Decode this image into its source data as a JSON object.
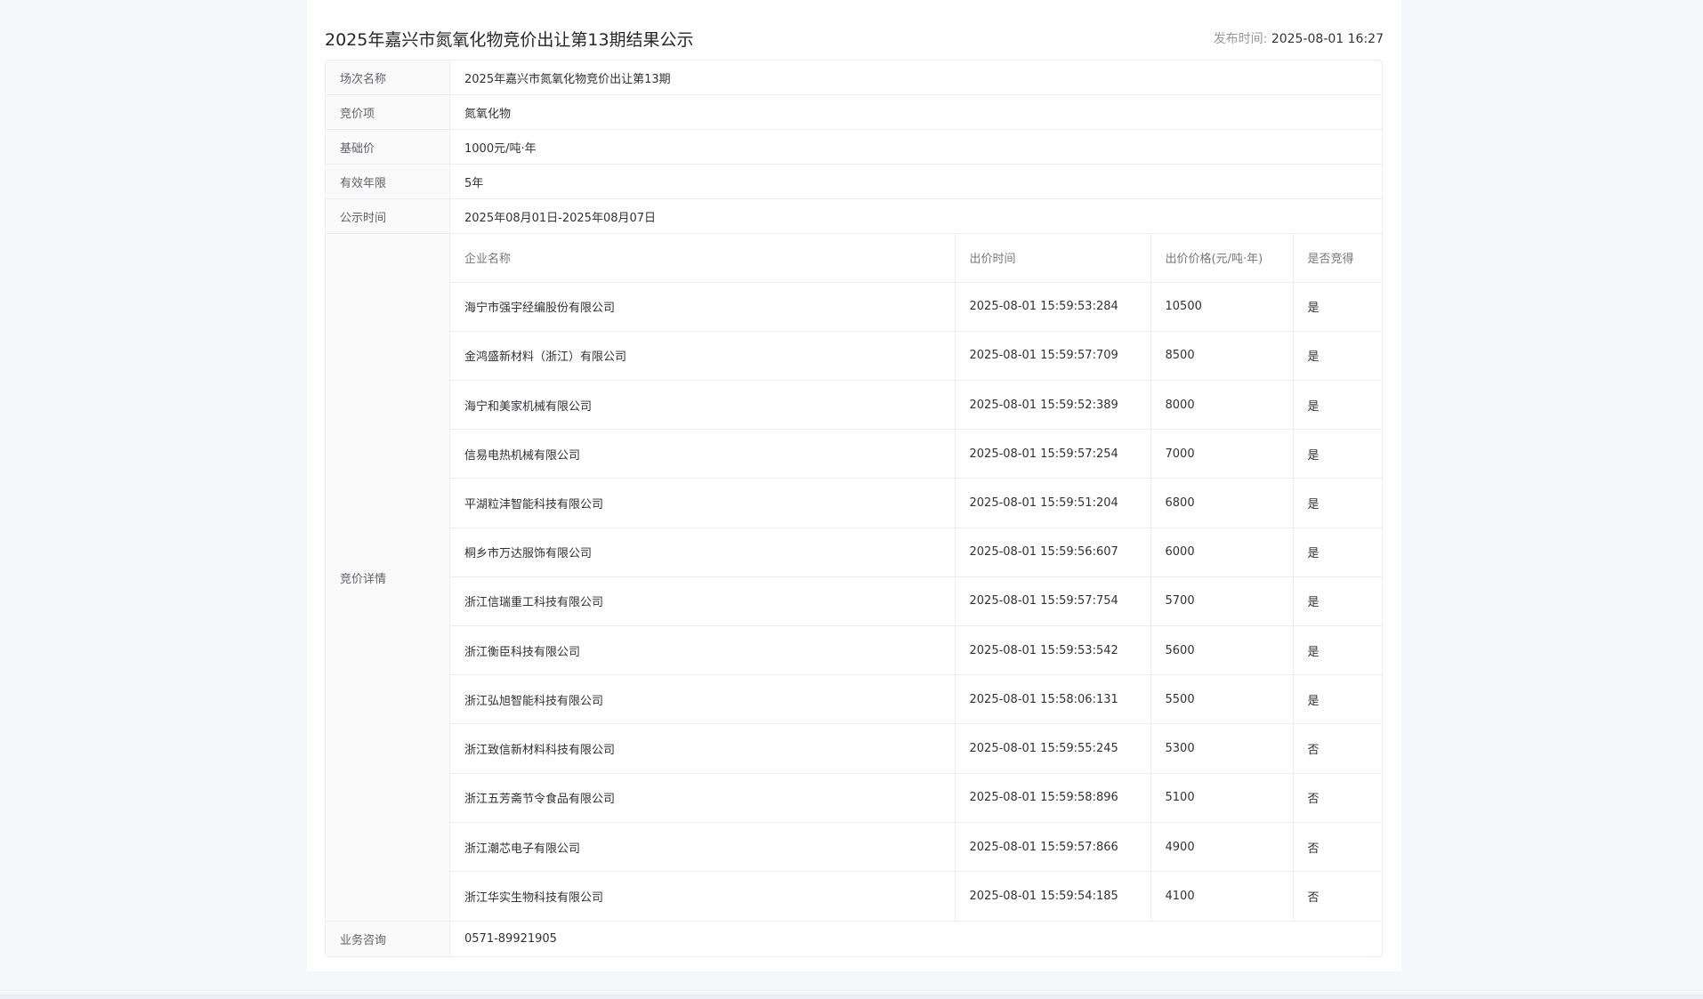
{
  "header": {
    "title": "2025年嘉兴市氮氧化物竞价出让第13期结果公示",
    "publish_label": "发布时间: ",
    "publish_time": "2025-08-01 16:27"
  },
  "info": {
    "session_label": "场次名称",
    "session_value": "2025年嘉兴市氮氧化物竞价出让第13期",
    "item_label": "竞价项",
    "item_value": "氮氧化物",
    "base_price_label": "基础价",
    "base_price_value": "1000元/吨·年",
    "validity_label": "有效年限",
    "validity_value": "5年",
    "period_label": "公示时间",
    "period_value": "2025年08月01日-2025年08月07日",
    "detail_label": "竞价详情",
    "consult_label": "业务咨询",
    "consult_value": "0571-89921905"
  },
  "bids": {
    "columns": [
      "企业名称",
      "出价时间",
      "出价价格(元/吨·年)",
      "是否竞得"
    ],
    "rows": [
      [
        "海宁市强宇经编股份有限公司",
        "2025-08-01 15:59:53:284",
        "10500",
        "是"
      ],
      [
        "金鸿盛新材料（浙江）有限公司",
        "2025-08-01 15:59:57:709",
        "8500",
        "是"
      ],
      [
        "海宁和美家机械有限公司",
        "2025-08-01 15:59:52:389",
        "8000",
        "是"
      ],
      [
        "信易电热机械有限公司",
        "2025-08-01 15:59:57:254",
        "7000",
        "是"
      ],
      [
        "平湖粒沣智能科技有限公司",
        "2025-08-01 15:59:51:204",
        "6800",
        "是"
      ],
      [
        "桐乡市万达服饰有限公司",
        "2025-08-01 15:59:56:607",
        "6000",
        "是"
      ],
      [
        "浙江信瑞重工科技有限公司",
        "2025-08-01 15:59:57:754",
        "5700",
        "是"
      ],
      [
        "浙江衡臣科技有限公司",
        "2025-08-01 15:59:53:542",
        "5600",
        "是"
      ],
      [
        "浙江弘旭智能科技有限公司",
        "2025-08-01 15:58:06:131",
        "5500",
        "是"
      ],
      [
        "浙江致信新材料科技有限公司",
        "2025-08-01 15:59:55:245",
        "5300",
        "否"
      ],
      [
        "浙江五芳斋节令食品有限公司",
        "2025-08-01 15:59:58:896",
        "5100",
        "否"
      ],
      [
        "浙江潮芯电子有限公司",
        "2025-08-01 15:59:57:866",
        "4900",
        "否"
      ],
      [
        "浙江华实生物科技有限公司",
        "2025-08-01 15:59:54:185",
        "4100",
        "否"
      ]
    ]
  }
}
